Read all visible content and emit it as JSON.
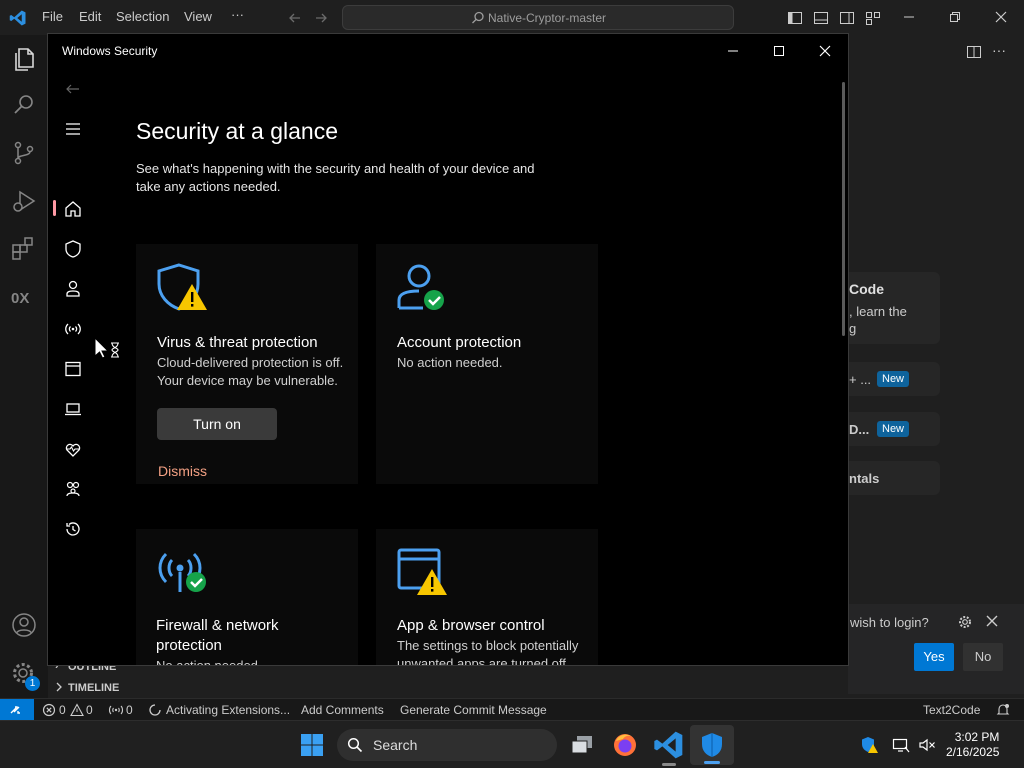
{
  "vscode": {
    "menu": [
      "File",
      "Edit",
      "Selection",
      "View",
      "···"
    ],
    "command_center": "Native-Cryptor-master",
    "walkthrough": {
      "title": "Code",
      "desc_line1": ", learn the",
      "desc_line2": "g",
      "item1": "+ ...",
      "item2": "D...",
      "item3": "ntals",
      "new_badge": "New"
    },
    "notification": {
      "message": "wish to login?",
      "yes": "Yes",
      "no": "No"
    },
    "sidebar": {
      "outline": "OUTLINE",
      "timeline": "TIMELINE"
    },
    "accounts_badge": "1",
    "statusbar": {
      "errors": "0",
      "warnings": "0",
      "ports": "0",
      "activating": "Activating Extensions...",
      "add_comments": "Add Comments",
      "commit_msg": "Generate Commit Message",
      "text2code": "Text2Code"
    }
  },
  "security": {
    "window_title": "Windows Security",
    "heading": "Security at a glance",
    "subtext": "See what's happening with the security and health of your device and take any actions needed.",
    "tiles": [
      {
        "title": "Virus & threat protection",
        "desc": "Cloud-delivered protection is off. Your device may be vulnerable.",
        "action": "Turn on",
        "dismiss": "Dismiss",
        "status": "warning"
      },
      {
        "title": "Account protection",
        "desc": "No action needed.",
        "status": "ok"
      },
      {
        "title": "Firewall & network protection",
        "desc": "No action needed.",
        "status": "ok"
      },
      {
        "title": "App & browser control",
        "desc": "The settings to block potentially unwanted apps are turned off.",
        "status": "warning"
      }
    ]
  },
  "taskbar": {
    "search_label": "Search",
    "time": "3:02 PM",
    "date": "2/16/2025"
  },
  "colors": {
    "accent_blue": "#0078d4",
    "icon_blue": "#4ca0f0",
    "warning": "#f7c600",
    "ok": "#16a34a",
    "dismiss": "#f4a184"
  }
}
